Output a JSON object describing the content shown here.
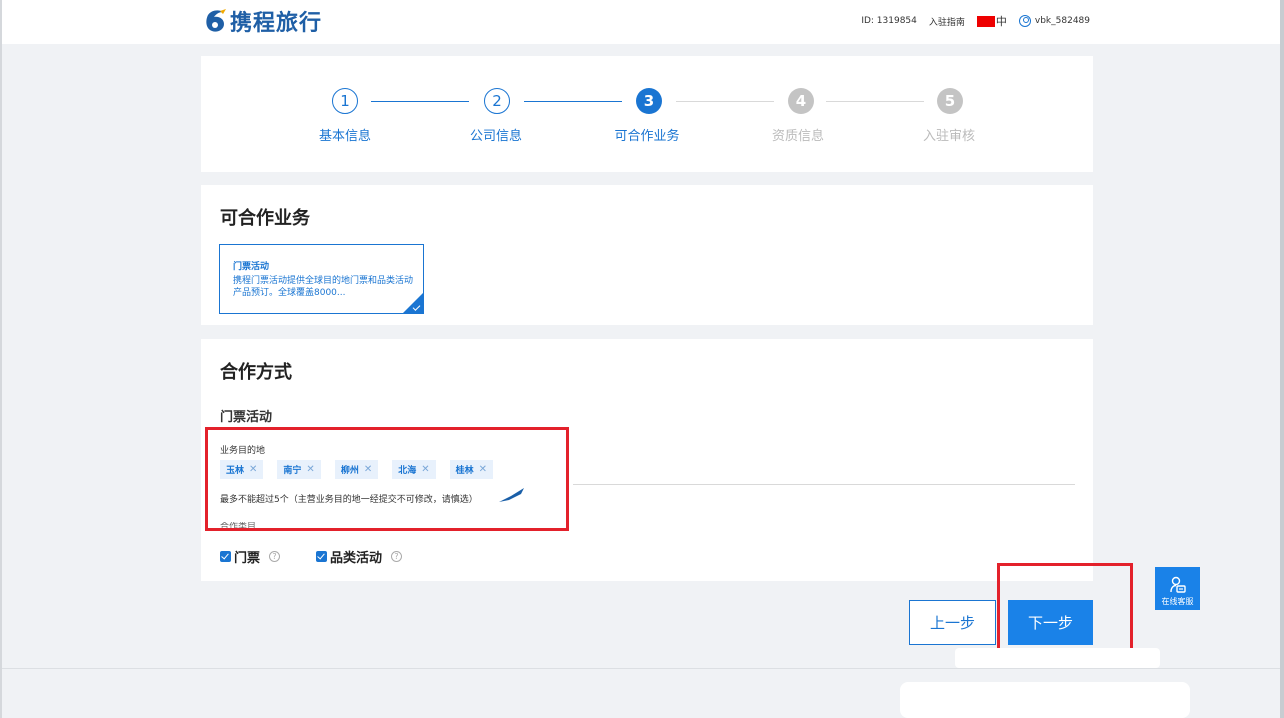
{
  "header": {
    "logo_text": "携程旅行",
    "id_text": "ID: 1319854",
    "guide_link": "入驻指南",
    "language": "中",
    "username": "vbk_582489"
  },
  "steps": [
    {
      "number": "1",
      "label": "基本信息",
      "state": "done"
    },
    {
      "number": "2",
      "label": "公司信息",
      "state": "done"
    },
    {
      "number": "3",
      "label": "可合作业务",
      "state": "active"
    },
    {
      "number": "4",
      "label": "资质信息",
      "state": "todo"
    },
    {
      "number": "5",
      "label": "入驻审核",
      "state": "todo"
    }
  ],
  "business": {
    "title": "可合作业务",
    "item_title": "门票活动",
    "item_desc": "携程门票活动提供全球目的地门票和品类活动产品预订。全球覆盖8000..."
  },
  "cooperation": {
    "title": "合作方式",
    "subtitle": "门票活动",
    "destination_label": "业务目的地",
    "destinations": [
      {
        "name": "玉林"
      },
      {
        "name": "南宁"
      },
      {
        "name": "柳州"
      },
      {
        "name": "北海"
      },
      {
        "name": "桂林"
      }
    ],
    "hint": "最多不能超过5个（主营业务目的地一经提交不可修改，请慎选）",
    "category_label": "合作类目",
    "options": [
      {
        "label": "门票",
        "checked": true
      },
      {
        "label": "品类活动",
        "checked": true
      }
    ]
  },
  "buttons": {
    "prev": "上一步",
    "next": "下一步"
  },
  "service": {
    "label": "在线客服"
  },
  "colors": {
    "primary": "#1a75d2",
    "button": "#1a82e8",
    "annotation": "#e3212b"
  }
}
